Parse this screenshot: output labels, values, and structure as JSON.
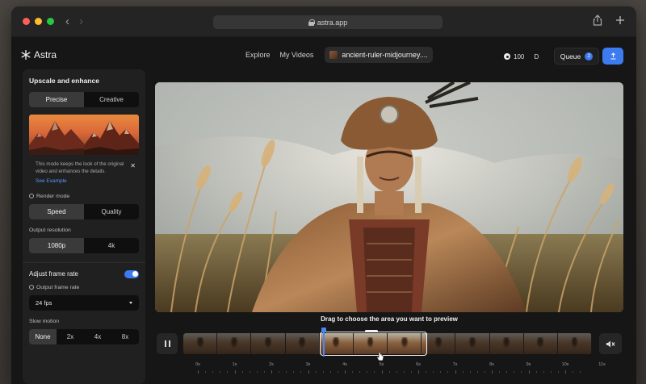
{
  "browser": {
    "url": "astra.app"
  },
  "app": {
    "name": "Astra",
    "nav_links": [
      "Explore",
      "My Videos"
    ],
    "project_name": "ancient-ruler-midjourney....",
    "credits": "100",
    "user_initial": "D",
    "queue_label": "Queue",
    "queue_count": "2"
  },
  "sidebar": {
    "title": "Upscale and enhance",
    "mode_options": [
      "Precise",
      "Creative"
    ],
    "mode_selected": "Precise",
    "info_text": "This mode keeps the look of the original video and enhances the details.",
    "see_example": "See Example",
    "render_mode_label": "Render mode",
    "render_options": [
      "Speed",
      "Quality"
    ],
    "render_selected": "Speed",
    "resolution_label": "Output resolution",
    "resolution_options": [
      "1080p",
      "4k"
    ],
    "resolution_selected": "1080p",
    "frame_rate_title": "Adjust frame rate",
    "frame_rate_enabled": true,
    "output_frame_rate_label": "Output frame rate",
    "output_frame_rate_value": "24 fps",
    "slow_motion_label": "Slow motion",
    "slow_motion_options": [
      "None",
      "2x",
      "4x",
      "8x"
    ],
    "slow_motion_selected": "None"
  },
  "player": {
    "drag_hint": "Drag to choose the area you want to preview",
    "timeline_ticks": [
      "0s",
      "1s",
      "2s",
      "3s",
      "4s",
      "5s",
      "6s",
      "7s",
      "8s",
      "9s",
      "10s",
      "11s"
    ]
  },
  "colors": {
    "accent": "#3d7bf0",
    "panel": "#202020",
    "background": "#161616"
  }
}
